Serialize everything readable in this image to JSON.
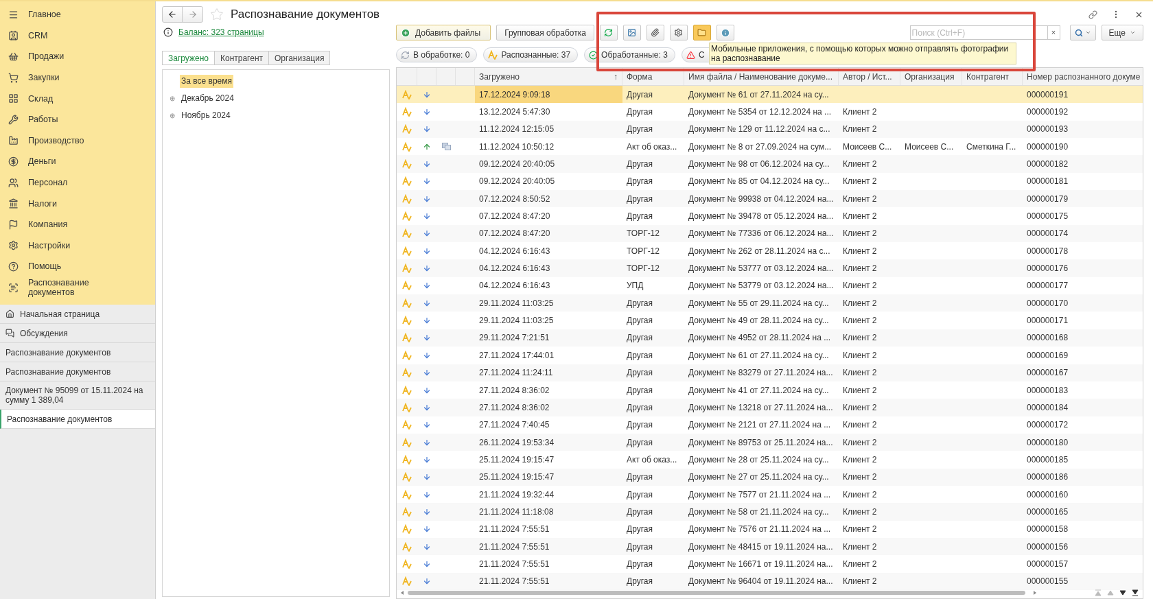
{
  "sidebar": {
    "sections": [
      {
        "label": "Главное"
      },
      {
        "label": "CRM"
      },
      {
        "label": "Продажи"
      },
      {
        "label": "Закупки"
      },
      {
        "label": "Склад"
      },
      {
        "label": "Работы"
      },
      {
        "label": "Производство"
      },
      {
        "label": "Деньги"
      },
      {
        "label": "Персонал"
      },
      {
        "label": "Налоги"
      },
      {
        "label": "Компания"
      },
      {
        "label": "Настройки"
      },
      {
        "label": "Помощь"
      },
      {
        "label": "Распознавание документов"
      }
    ],
    "open_windows": [
      {
        "label": "Начальная страница",
        "selected": false
      },
      {
        "label": "Обсуждения",
        "selected": false
      },
      {
        "label": "Распознавание документов",
        "selected": false
      },
      {
        "label": "Распознавание документов",
        "selected": false
      },
      {
        "label": "Документ № 95099 от 15.11.2024 на сумму 1 389,04",
        "selected": false
      },
      {
        "label": "Распознавание документов",
        "selected": true
      }
    ]
  },
  "window": {
    "title": "Распознавание документов",
    "balance_link": "Баланс: 323 страницы"
  },
  "left_panel": {
    "tabs": [
      {
        "label": "Загружено",
        "selected": true
      },
      {
        "label": "Контрагент",
        "selected": false
      },
      {
        "label": "Организация",
        "selected": false
      }
    ],
    "tree": [
      {
        "label": "За все время",
        "selected": true
      },
      {
        "label": "Декабрь 2024",
        "selected": false,
        "expander": "⊕"
      },
      {
        "label": "Ноябрь 2024",
        "selected": false,
        "expander": "⊕"
      }
    ]
  },
  "toolbar": {
    "add_button": "Добавить файлы",
    "group_button": "Групповая обработка",
    "mobile_apps_pressed": true,
    "search": {
      "placeholder": "Поиск (Ctrl+F)"
    },
    "clear": "×",
    "more_button": "Еще"
  },
  "tooltip": "Мобильные приложения, с помощью которых можно отправлять фотографии на распознавание",
  "filters": [
    {
      "kind": "processing",
      "label": "В обработке: 0"
    },
    {
      "kind": "recognized",
      "label": "Распознанные: 37"
    },
    {
      "kind": "processed",
      "label": "Обработанные: 3"
    },
    {
      "kind": "errors",
      "label": "С"
    }
  ],
  "table": {
    "columns": [
      {
        "label": "Загружено",
        "sort_mark": "↑"
      },
      {
        "label": "Форма"
      },
      {
        "label": "Имя файла / Наименование докуме..."
      },
      {
        "label": "Автор / Ист..."
      },
      {
        "label": "Организация"
      },
      {
        "label": "Контрагент"
      },
      {
        "label": "Номер распознанного докуме"
      }
    ],
    "rows": [
      {
        "selected": true,
        "outgoing": false,
        "duplicate": false,
        "uploaded": "17.12.2024 9:09:18",
        "form": "Другая",
        "name": "Документ № 61 от 27.11.2024 на су...",
        "number": "000000191"
      },
      {
        "selected": false,
        "outgoing": false,
        "duplicate": false,
        "uploaded": "13.12.2024 5:47:30",
        "form": "Другая",
        "name": "Документ № 5354 от 12.12.2024 на ...",
        "author": "Клиент 2",
        "number": "000000192"
      },
      {
        "selected": false,
        "outgoing": false,
        "duplicate": false,
        "uploaded": "11.12.2024 12:15:05",
        "form": "Другая",
        "name": "Документ № 129 от 11.12.2024 на с...",
        "author": "Клиент 2",
        "number": "000000193"
      },
      {
        "selected": false,
        "outgoing": true,
        "duplicate": true,
        "uploaded": "11.12.2024 10:50:12",
        "form": "Акт об оказ...",
        "name": "Документ № 8 от 27.09.2024 на сум...",
        "author": "Моисеев С...",
        "org": "Моисеев С...",
        "contractor": "Сметкина Г...",
        "number": "000000190"
      },
      {
        "selected": false,
        "outgoing": false,
        "duplicate": false,
        "uploaded": "09.12.2024 20:40:05",
        "form": "Другая",
        "name": "Документ № 98 от 06.12.2024 на су...",
        "author": "Клиент 2",
        "number": "000000182"
      },
      {
        "selected": false,
        "outgoing": false,
        "duplicate": false,
        "uploaded": "09.12.2024 20:40:05",
        "form": "Другая",
        "name": "Документ № 85 от 04.12.2024 на су...",
        "author": "Клиент 2",
        "number": "000000181"
      },
      {
        "selected": false,
        "outgoing": false,
        "duplicate": false,
        "uploaded": "07.12.2024 8:50:52",
        "form": "Другая",
        "name": "Документ № 99938 от 04.12.2024 на...",
        "author": "Клиент 2",
        "number": "000000179"
      },
      {
        "selected": false,
        "outgoing": false,
        "duplicate": false,
        "uploaded": "07.12.2024 8:47:20",
        "form": "Другая",
        "name": "Документ № 39478 от 05.12.2024 на...",
        "author": "Клиент 2",
        "number": "000000175"
      },
      {
        "selected": false,
        "outgoing": false,
        "duplicate": false,
        "uploaded": "07.12.2024 8:47:20",
        "form": "ТОРГ-12",
        "name": "Документ № 77336 от 06.12.2024 на...",
        "author": "Клиент 2",
        "number": "000000174"
      },
      {
        "selected": false,
        "outgoing": false,
        "duplicate": false,
        "uploaded": "04.12.2024 6:16:43",
        "form": "ТОРГ-12",
        "name": "Документ № 262 от 28.11.2024 на с...",
        "author": "Клиент 2",
        "number": "000000178"
      },
      {
        "selected": false,
        "outgoing": false,
        "duplicate": false,
        "uploaded": "04.12.2024 6:16:43",
        "form": "ТОРГ-12",
        "name": "Документ № 53777 от 03.12.2024 на...",
        "author": "Клиент 2",
        "number": "000000176"
      },
      {
        "selected": false,
        "outgoing": false,
        "duplicate": false,
        "uploaded": "04.12.2024 6:16:43",
        "form": "УПД",
        "name": "Документ № 53779 от 03.12.2024 на...",
        "author": "Клиент 2",
        "number": "000000177"
      },
      {
        "selected": false,
        "outgoing": false,
        "duplicate": false,
        "uploaded": "29.11.2024 11:03:25",
        "form": "Другая",
        "name": "Документ № 55 от 29.11.2024 на су...",
        "author": "Клиент 2",
        "number": "000000170"
      },
      {
        "selected": false,
        "outgoing": false,
        "duplicate": false,
        "uploaded": "29.11.2024 11:03:25",
        "form": "Другая",
        "name": "Документ № 49 от 28.11.2024 на су...",
        "author": "Клиент 2",
        "number": "000000171"
      },
      {
        "selected": false,
        "outgoing": false,
        "duplicate": false,
        "uploaded": "29.11.2024 7:21:51",
        "form": "Другая",
        "name": "Документ № 4952 от 28.11.2024 на ...",
        "author": "Клиент 2",
        "number": "000000168"
      },
      {
        "selected": false,
        "outgoing": false,
        "duplicate": false,
        "uploaded": "27.11.2024 17:44:01",
        "form": "Другая",
        "name": "Документ № 61 от 27.11.2024 на су...",
        "author": "Клиент 2",
        "number": "000000169"
      },
      {
        "selected": false,
        "outgoing": false,
        "duplicate": false,
        "uploaded": "27.11.2024 11:24:11",
        "form": "Другая",
        "name": "Документ № 83279 от 27.11.2024 на...",
        "author": "Клиент 2",
        "number": "000000167"
      },
      {
        "selected": false,
        "outgoing": false,
        "duplicate": false,
        "uploaded": "27.11.2024 8:36:02",
        "form": "Другая",
        "name": "Документ № 41 от 27.11.2024 на су...",
        "author": "Клиент 2",
        "number": "000000183"
      },
      {
        "selected": false,
        "outgoing": false,
        "duplicate": false,
        "uploaded": "27.11.2024 8:36:02",
        "form": "Другая",
        "name": "Документ № 13218 от 27.11.2024 на...",
        "author": "Клиент 2",
        "number": "000000184"
      },
      {
        "selected": false,
        "outgoing": false,
        "duplicate": false,
        "uploaded": "27.11.2024 7:40:45",
        "form": "Другая",
        "name": "Документ № 2121 от 27.11.2024 на ...",
        "author": "Клиент 2",
        "number": "000000172"
      },
      {
        "selected": false,
        "outgoing": false,
        "duplicate": false,
        "uploaded": "26.11.2024 19:53:34",
        "form": "Другая",
        "name": "Документ № 89753 от 25.11.2024 на...",
        "author": "Клиент 2",
        "number": "000000180"
      },
      {
        "selected": false,
        "outgoing": false,
        "duplicate": false,
        "uploaded": "25.11.2024 19:15:47",
        "form": "Акт об оказ...",
        "name": "Документ № 28 от 25.11.2024 на су...",
        "author": "Клиент 2",
        "number": "000000185"
      },
      {
        "selected": false,
        "outgoing": false,
        "duplicate": false,
        "uploaded": "25.11.2024 19:15:47",
        "form": "Другая",
        "name": "Документ № 27 от 25.11.2024 на су...",
        "author": "Клиент 2",
        "number": "000000186"
      },
      {
        "selected": false,
        "outgoing": false,
        "duplicate": false,
        "uploaded": "21.11.2024 19:32:44",
        "form": "Другая",
        "name": "Документ № 7577 от 21.11.2024 на ...",
        "author": "Клиент 2",
        "number": "000000160"
      },
      {
        "selected": false,
        "outgoing": false,
        "duplicate": false,
        "uploaded": "21.11.2024 11:18:08",
        "form": "Другая",
        "name": "Документ № 58 от 21.11.2024 на су...",
        "author": "Клиент 2",
        "number": "000000165"
      },
      {
        "selected": false,
        "outgoing": false,
        "duplicate": false,
        "uploaded": "21.11.2024 7:55:51",
        "form": "Другая",
        "name": "Документ № 7576 от 21.11.2024 на ...",
        "author": "Клиент 2",
        "number": "000000158"
      },
      {
        "selected": false,
        "outgoing": false,
        "duplicate": false,
        "uploaded": "21.11.2024 7:55:51",
        "form": "Другая",
        "name": "Документ № 48415 от 19.11.2024 на...",
        "author": "Клиент 2",
        "number": "000000156"
      },
      {
        "selected": false,
        "outgoing": false,
        "duplicate": false,
        "uploaded": "21.11.2024 7:55:51",
        "form": "Другая",
        "name": "Документ № 16671 от 19.11.2024 на...",
        "author": "Клиент 2",
        "number": "000000157"
      },
      {
        "selected": false,
        "outgoing": false,
        "duplicate": false,
        "uploaded": "21.11.2024 7:55:51",
        "form": "Другая",
        "name": "Документ № 96404 от 19.11.2024 на...",
        "author": "Клиент 2",
        "number": "000000155"
      }
    ]
  }
}
